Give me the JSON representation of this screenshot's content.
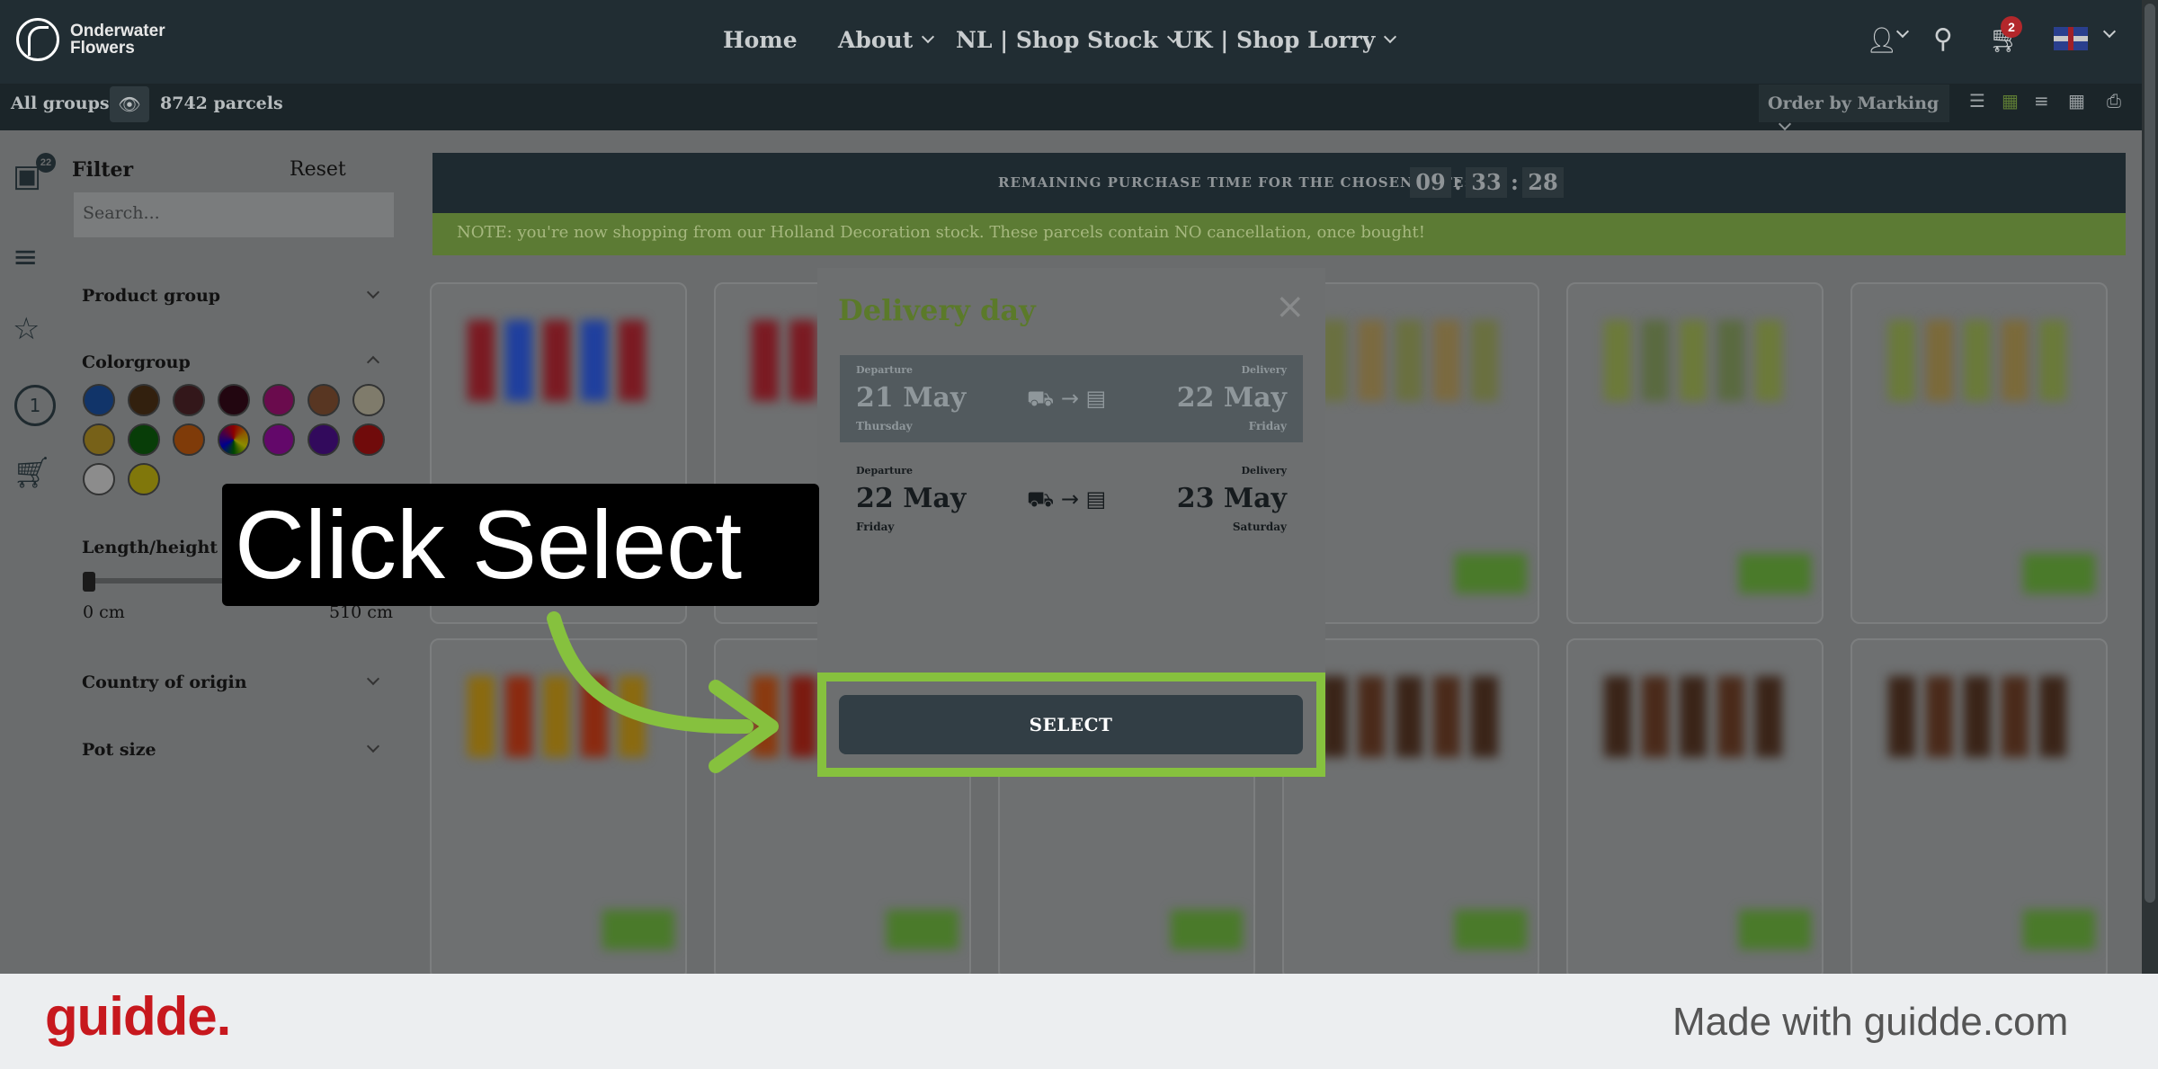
{
  "app": {
    "logo_line1": "Onderwater",
    "logo_line2": "Flowers"
  },
  "nav": {
    "home": "Home",
    "about": "About",
    "nl_shop": "NL | Shop Stock",
    "uk_shop": "UK | Shop Lorry"
  },
  "cart": {
    "count": "2"
  },
  "subbar": {
    "all_groups": "All groups:",
    "parcels": "8742 parcels",
    "order_by": "Order by Marking"
  },
  "sidebar": {
    "basket_count": "22",
    "step_number": "1"
  },
  "filter": {
    "title": "Filter",
    "reset": "Reset",
    "search_placeholder": "Search...",
    "product_group": "Product group",
    "colorgroup": "Colorgroup",
    "length_height": "Length/height",
    "min": "0 cm",
    "max": "510 cm",
    "country": "Country of origin",
    "pot_size": "Pot size",
    "colors": [
      "#1f5fbf",
      "#5a3a1a",
      "#5c2a2f",
      "#3d0a1d",
      "#c0148c",
      "#a0623e",
      "#e6dfc2",
      "#d8b02c",
      "#0f6e0f",
      "#e66b10",
      "rainbow",
      "#b40fc0",
      "#5a12a8",
      "#cc1414",
      "#ffffff",
      "#e8d814"
    ]
  },
  "timer": {
    "label": "REMAINING PURCHASE TIME FOR THE CHOSEN DATE:",
    "hh": "09",
    "mm": "33",
    "ss": "28"
  },
  "note": "NOTE: you're now shopping from our Holland Decoration stock. These parcels contain NO cancellation, once bought!",
  "modal": {
    "title": "Delivery day",
    "options": [
      {
        "departure_label": "Departure",
        "departure_date": "21 May",
        "departure_day": "Thursday",
        "delivery_label": "Delivery",
        "delivery_date": "22 May",
        "delivery_day": "Friday",
        "selected": true
      },
      {
        "departure_label": "Departure",
        "departure_date": "22 May",
        "departure_day": "Friday",
        "delivery_label": "Delivery",
        "delivery_date": "23 May",
        "delivery_day": "Saturday",
        "selected": false
      }
    ],
    "select_label": "SELECT"
  },
  "callout": {
    "text": "Click Select",
    "accent": "#86c13e"
  },
  "footer": {
    "brand": "guidde.",
    "made_with": "Made with guidde.com"
  }
}
